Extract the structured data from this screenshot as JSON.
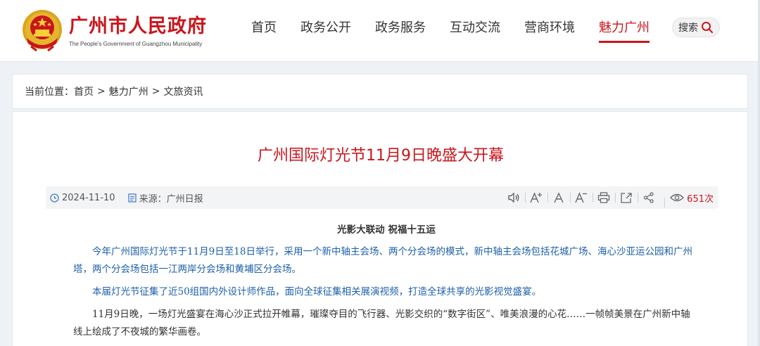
{
  "header": {
    "site_title": "广州市人民政府",
    "site_subtitle": "The People's Government of Guangzhou Municipality",
    "nav": [
      {
        "label": "首页",
        "active": false
      },
      {
        "label": "政务公开",
        "active": false
      },
      {
        "label": "政务服务",
        "active": false
      },
      {
        "label": "互动交流",
        "active": false
      },
      {
        "label": "营商环境",
        "active": false
      },
      {
        "label": "魅力广州",
        "active": true
      }
    ],
    "search_label": "搜索",
    "search_icon": "magnifier-icon"
  },
  "breadcrumb": {
    "prefix": "当前位置：",
    "items": [
      "首页",
      "魅力广州",
      "文旅资讯"
    ],
    "separator": ">"
  },
  "article": {
    "title": "广州国际灯光节11月9日晚盛大开幕",
    "date": "2024-11-10",
    "source": "来源：广州日报",
    "views_count": "651次",
    "tools": [
      {
        "icon": "speaker-icon",
        "label": "speaker"
      },
      {
        "icon": "font-increase-icon",
        "label": "A+"
      },
      {
        "icon": "font-normal-icon",
        "label": "A"
      },
      {
        "icon": "font-decrease-icon",
        "label": "A-"
      },
      {
        "icon": "print-icon",
        "label": "print"
      },
      {
        "icon": "share-export-icon",
        "label": "export"
      },
      {
        "icon": "share-icon",
        "label": "share"
      }
    ],
    "subhead": "光影大联动 祝福十五运",
    "paragraphs": [
      "今年广州国际灯光节于11月9日至18日举行，采用一个新中轴主会场、两个分会场的模式，新中轴主会场包括花城广场、海心沙亚运公园和广州塔，两个分会场包括一江两岸分会场和黄埔区分会场。",
      "本届灯光节征集了近50组国内外设计师作品，面向全球征集相关展演视频，打造全球共享的光影视觉盛宴。",
      "11月9日晚，一场灯光盛宴在海心沙正式拉开帷幕，璀璨夺目的飞行器、光影交织的“数字街区”、唯美浪漫的心花……一帧帧美景在广州新中轴线上绘成了不夜城的繁华画卷。"
    ]
  },
  "colors": {
    "brand_red": "#c8161d",
    "link_blue": "#1d5fa8",
    "page_bg": "#eef2f6"
  }
}
